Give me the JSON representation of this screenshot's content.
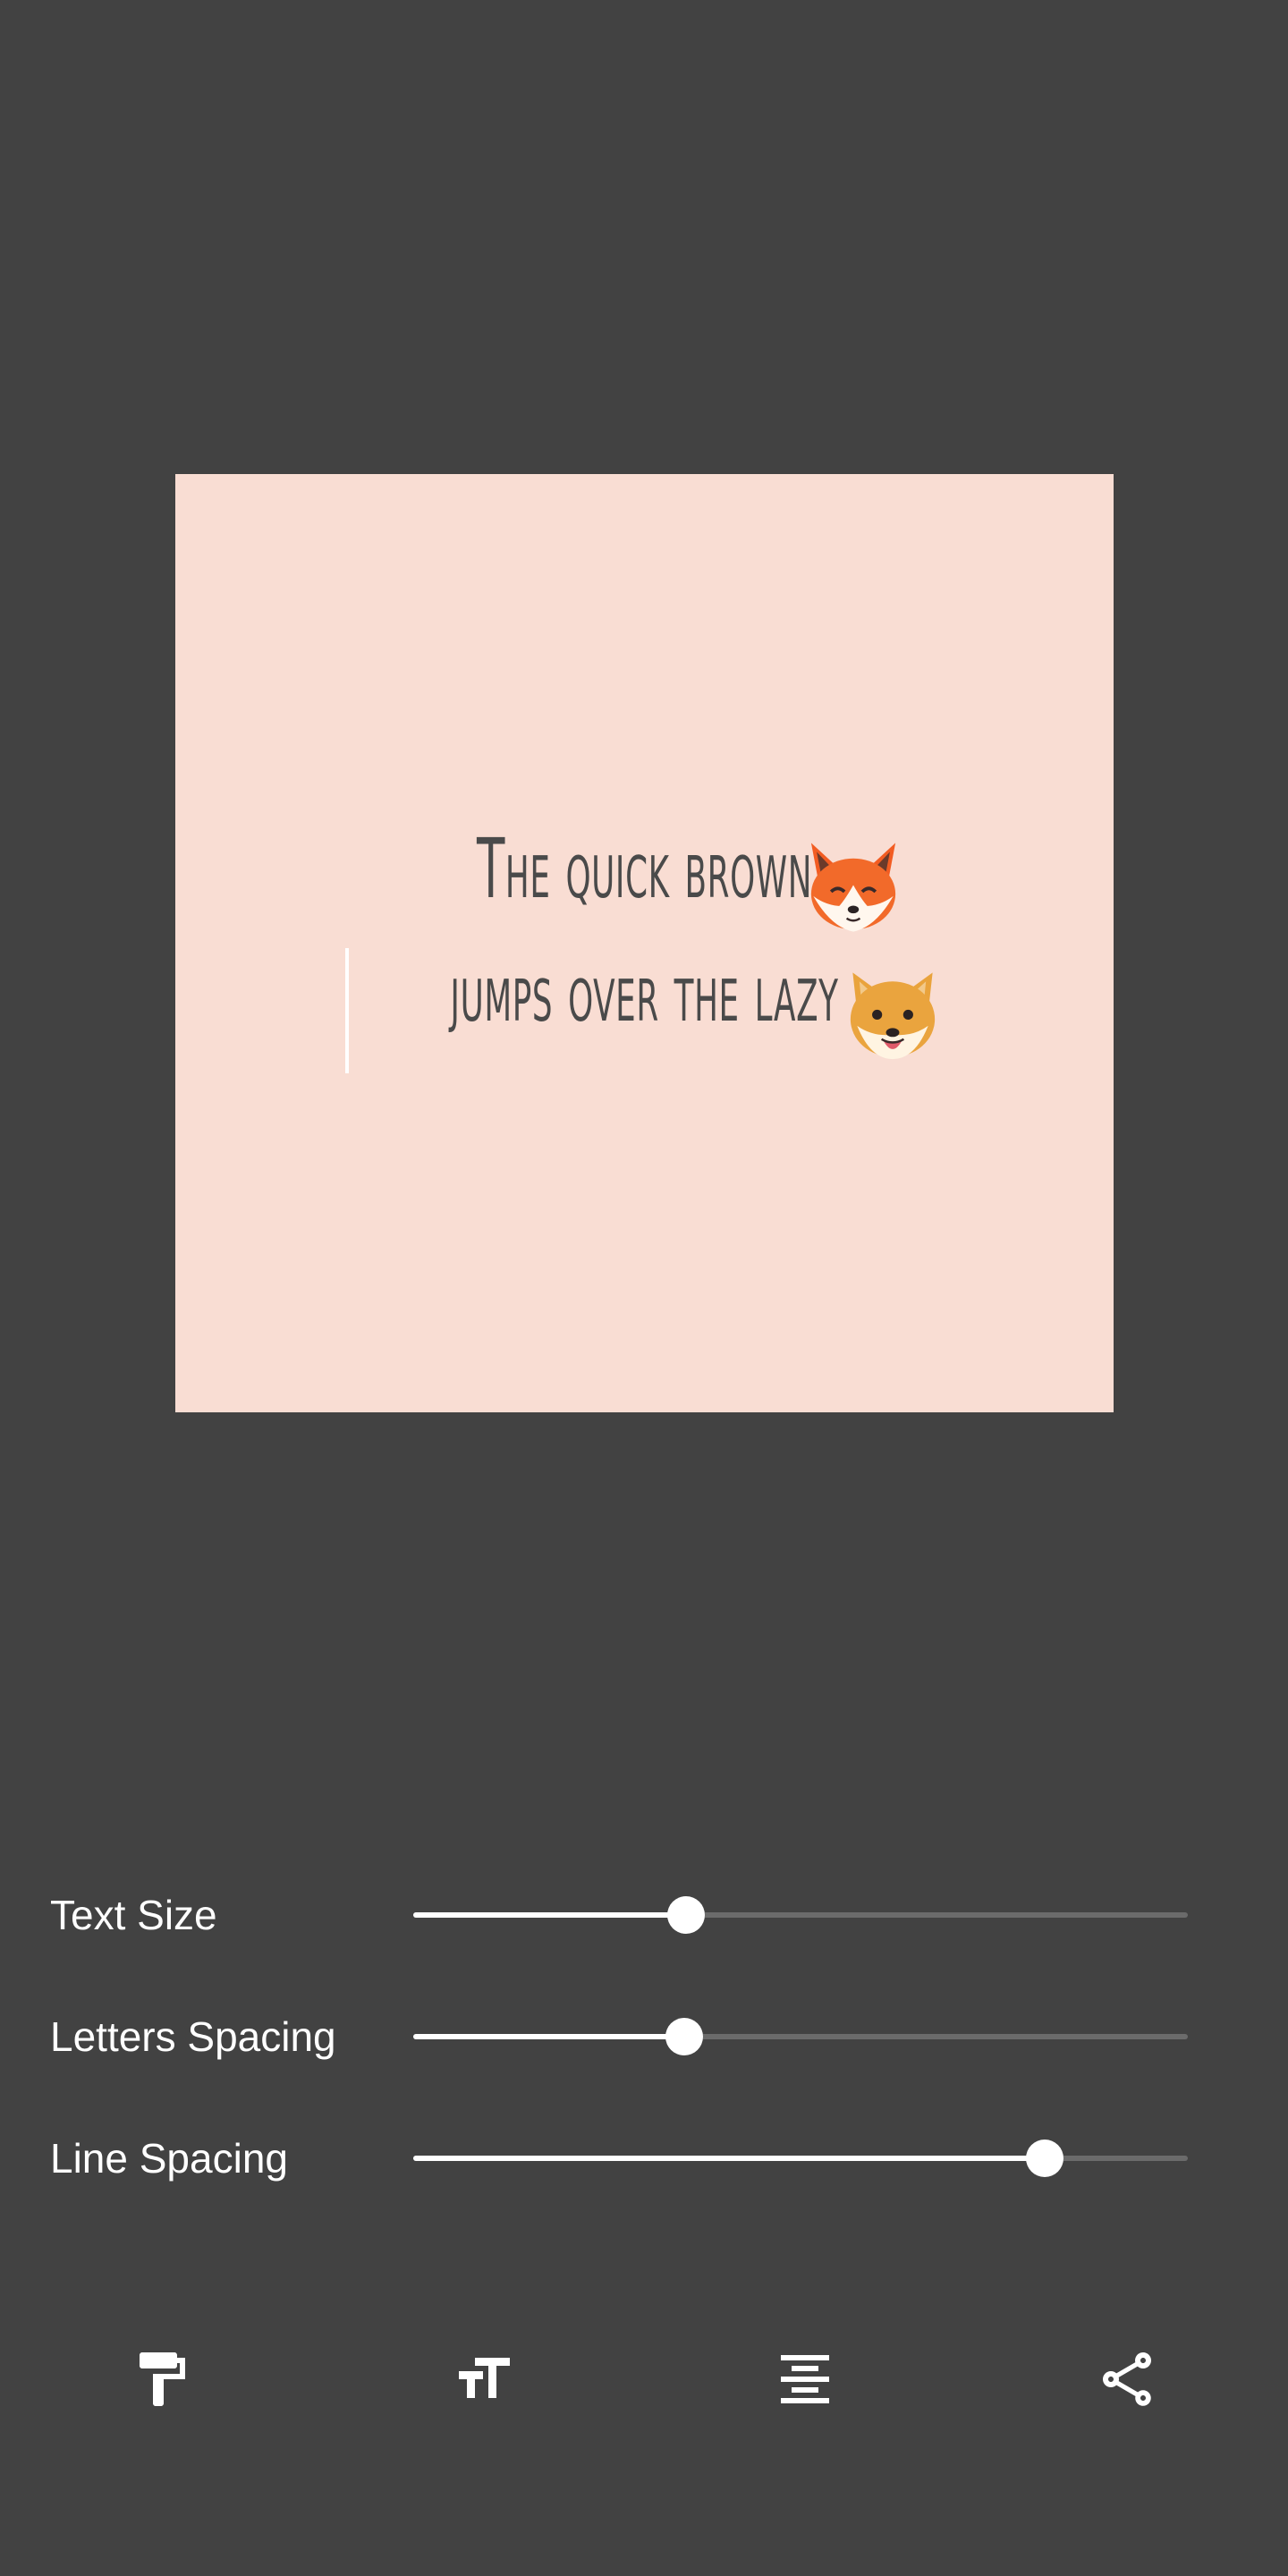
{
  "canvas": {
    "background": "#f9ddd3",
    "text_color": "#4a4a4a",
    "lines": [
      {
        "text": "The quick brown",
        "emoji": "fox-face-icon"
      },
      {
        "text": "jumps over the lazy",
        "emoji": "dog-face-icon"
      }
    ]
  },
  "sliders": [
    {
      "label": "Text Size",
      "value": 0.35
    },
    {
      "label": "Letters Spacing",
      "value": 0.35
    },
    {
      "label": "Line Spacing",
      "value": 0.815
    }
  ],
  "toolbar": [
    {
      "icon": "paint-roller-icon"
    },
    {
      "icon": "text-size-icon"
    },
    {
      "icon": "align-center-icon"
    },
    {
      "icon": "share-icon"
    }
  ]
}
